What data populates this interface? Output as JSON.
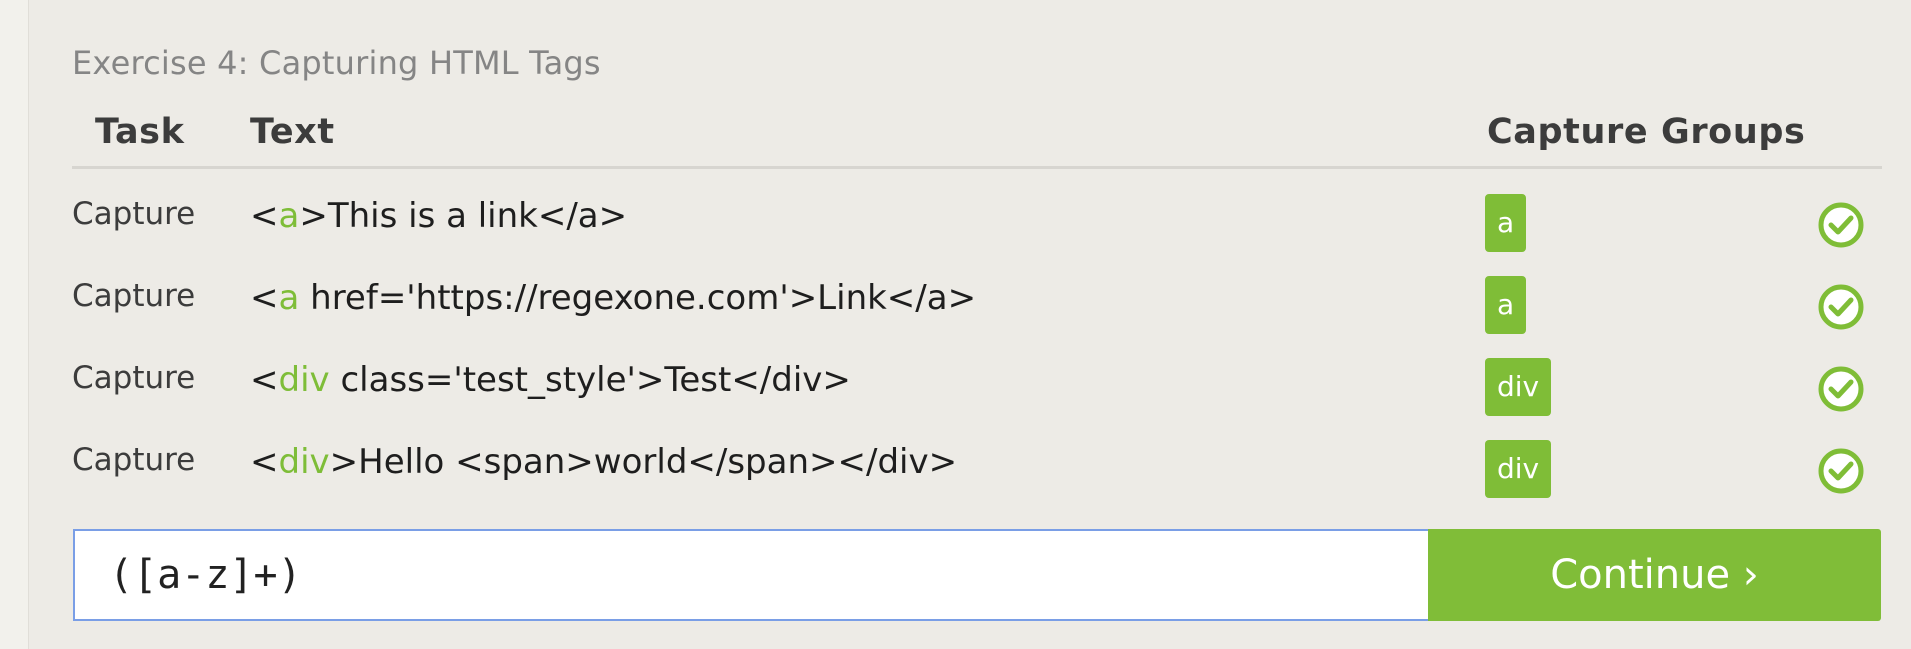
{
  "exercise": {
    "title": "Exercise 4: Capturing HTML Tags"
  },
  "table": {
    "headers": {
      "task": "Task",
      "text": "Text",
      "groups": "Capture Groups"
    },
    "rows": [
      {
        "task": "Capture",
        "text_open": "<",
        "text_match": "a",
        "text_rest": ">This is a link</a>",
        "group": "a",
        "status": "check-icon"
      },
      {
        "task": "Capture",
        "text_open": "<",
        "text_match": "a",
        "text_rest": " href='https://regexone.com'>Link</a>",
        "group": "a",
        "status": "check-icon"
      },
      {
        "task": "Capture",
        "text_open": "<",
        "text_match": "div",
        "text_rest": " class='test_style'>Test</div>",
        "group": "div",
        "status": "check-icon"
      },
      {
        "task": "Capture",
        "text_open": "<",
        "text_match": "div",
        "text_rest": ">Hello <span>world</span></div>",
        "group": "div",
        "status": "check-icon"
      }
    ]
  },
  "input": {
    "value": "([a-z]+)"
  },
  "continue_button": {
    "label": "Continue ›"
  },
  "colors": {
    "accent_green": "#80bd38",
    "input_border": "#7a9ee6",
    "panel_bg": "#edebe6"
  }
}
